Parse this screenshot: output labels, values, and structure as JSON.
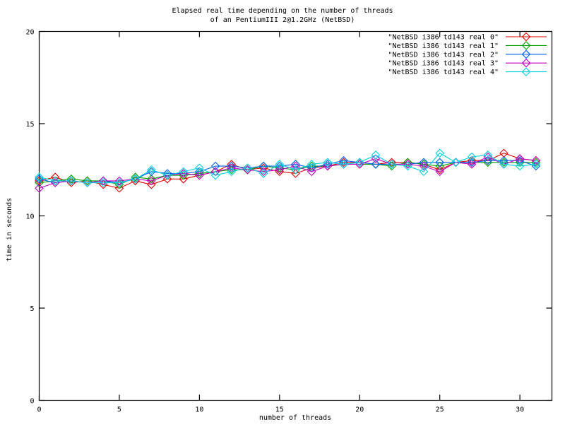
{
  "chart_data": {
    "type": "line",
    "title": "Elapsed real time depending on the number of threads",
    "subtitle": "of an PentiumIII 2@1.2GHz (NetBSD)",
    "xlabel": "number of threads",
    "ylabel": "time in seconds",
    "xlim": [
      0,
      32
    ],
    "ylim": [
      0,
      20
    ],
    "xticks": [
      0,
      5,
      10,
      15,
      20,
      25,
      30
    ],
    "yticks": [
      0,
      5,
      10,
      15,
      20
    ],
    "grid": false,
    "legend_position": "top-right",
    "x": [
      0,
      1,
      2,
      3,
      4,
      5,
      6,
      7,
      8,
      9,
      10,
      11,
      12,
      13,
      14,
      15,
      16,
      17,
      18,
      19,
      20,
      21,
      22,
      23,
      24,
      25,
      26,
      27,
      28,
      29,
      30,
      31
    ],
    "series": [
      {
        "name": "\"NetBSD i386 td143 real 0\"",
        "color": "#e00000",
        "marker": "diamond",
        "values": [
          11.9,
          12.1,
          11.8,
          11.9,
          11.7,
          11.5,
          11.9,
          11.7,
          12.0,
          12.0,
          12.2,
          12.4,
          12.8,
          12.5,
          12.6,
          12.4,
          12.3,
          12.6,
          12.7,
          12.9,
          12.9,
          12.8,
          12.9,
          12.9,
          12.8,
          12.5,
          12.9,
          13.0,
          13.0,
          13.4,
          13.1,
          13.0
        ]
      },
      {
        "name": "\"NetBSD i386 td143 real 1\"",
        "color": "#00a000",
        "marker": "diamond",
        "values": [
          11.8,
          11.9,
          12.0,
          11.9,
          11.9,
          11.7,
          12.1,
          12.0,
          12.2,
          12.2,
          12.3,
          12.4,
          12.5,
          12.5,
          12.7,
          12.6,
          12.5,
          12.7,
          12.7,
          12.8,
          12.8,
          12.8,
          12.7,
          12.9,
          12.8,
          12.7,
          12.9,
          12.9,
          12.9,
          12.9,
          12.9,
          12.9
        ]
      },
      {
        "name": "\"NetBSD i386 td143 real 2\"",
        "color": "#0060f0",
        "marker": "diamond",
        "values": [
          12.0,
          11.8,
          11.9,
          11.8,
          11.9,
          11.8,
          12.0,
          12.4,
          12.3,
          12.3,
          12.4,
          12.7,
          12.7,
          12.6,
          12.7,
          12.7,
          12.8,
          12.6,
          12.8,
          13.0,
          12.9,
          12.8,
          12.8,
          12.8,
          12.9,
          12.9,
          12.9,
          12.9,
          13.0,
          13.0,
          13.0,
          12.7
        ]
      },
      {
        "name": "\"NetBSD i386 td143 real 3\"",
        "color": "#c000c0",
        "marker": "diamond",
        "values": [
          11.5,
          11.8,
          11.9,
          11.8,
          11.9,
          11.9,
          12.0,
          11.9,
          12.2,
          12.3,
          12.2,
          12.4,
          12.6,
          12.5,
          12.4,
          12.5,
          12.7,
          12.4,
          12.7,
          12.8,
          12.8,
          13.1,
          12.8,
          12.8,
          12.7,
          12.4,
          12.9,
          12.8,
          13.2,
          12.8,
          13.1,
          13.0
        ]
      },
      {
        "name": "\"NetBSD i386 td143 real 4\"",
        "color": "#00d0e0",
        "marker": "diamond",
        "values": [
          12.1,
          11.9,
          11.9,
          11.8,
          11.8,
          11.8,
          12.0,
          12.5,
          12.2,
          12.4,
          12.6,
          12.2,
          12.4,
          12.6,
          12.3,
          12.8,
          12.5,
          12.8,
          12.9,
          12.8,
          12.9,
          13.3,
          12.8,
          12.7,
          12.4,
          13.4,
          12.9,
          13.2,
          13.3,
          12.8,
          12.7,
          12.8
        ]
      }
    ]
  },
  "axes": {
    "y_label": "time in seconds",
    "x_label": "number of threads",
    "y_tick_labels": [
      "0",
      "5",
      "10",
      "15",
      "20"
    ],
    "x_tick_labels": [
      "0",
      "5",
      "10",
      "15",
      "20",
      "25",
      "30"
    ]
  },
  "title": {
    "line1": "Elapsed real time depending on the number of threads",
    "line2": "of an PentiumIII 2@1.2GHz (NetBSD)"
  }
}
